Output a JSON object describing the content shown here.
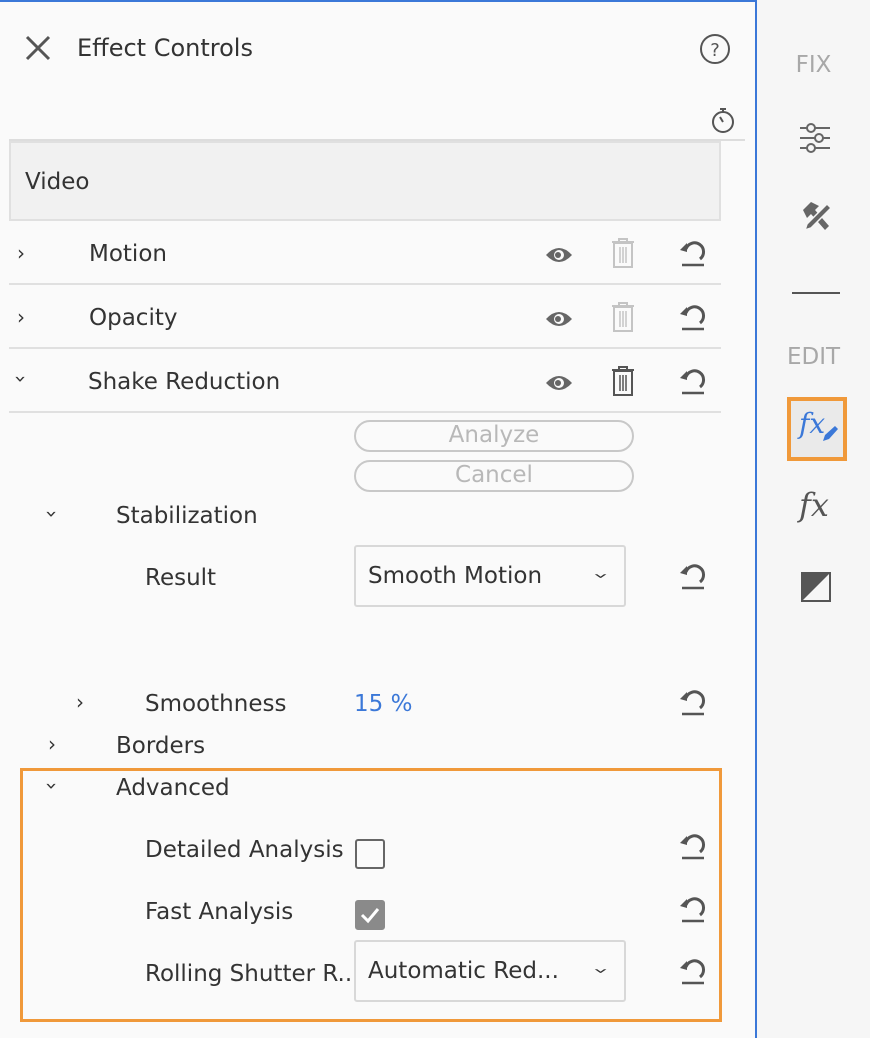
{
  "header": {
    "title": "Effect Controls",
    "close_icon": "close-icon",
    "help_icon": "help-icon",
    "timer_icon": "stopwatch-icon"
  },
  "section": {
    "title": "Video"
  },
  "effects": [
    {
      "label": "Motion",
      "expanded": false,
      "delete_enabled": false
    },
    {
      "label": "Opacity",
      "expanded": false,
      "delete_enabled": false
    },
    {
      "label": "Shake Reduction",
      "expanded": true,
      "delete_enabled": true
    }
  ],
  "shake": {
    "analyze_label": "Analyze",
    "cancel_label": "Cancel",
    "stabilization_label": "Stabilization",
    "result_label": "Result",
    "result_value": "Smooth Motion",
    "smoothness_label": "Smoothness",
    "smoothness_value": "15 %",
    "borders_label": "Borders",
    "advanced_label": "Advanced",
    "detailed_label": "Detailed Analysis",
    "detailed_checked": false,
    "fast_label": "Fast Analysis",
    "fast_checked": true,
    "rolling_label": "Rolling Shutter R...",
    "rolling_value": "Automatic Red..."
  },
  "sidebar": {
    "fix_label": "FIX",
    "edit_label": "EDIT",
    "active_item": "effect-controls",
    "highlight_color": "#f0993a",
    "accent_color": "#3b78d8"
  }
}
